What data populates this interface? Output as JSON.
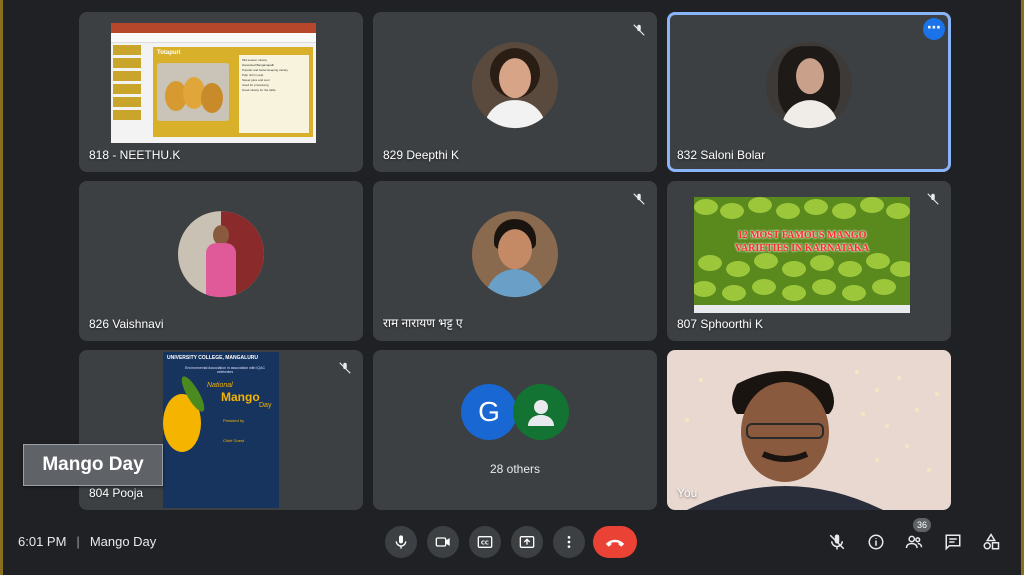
{
  "tiles": [
    {
      "name": "818 - NEETHU.K"
    },
    {
      "name": "829 Deepthi K"
    },
    {
      "name": "832 Saloni Bolar"
    },
    {
      "name": "826 Vaishnavi"
    },
    {
      "name": "राम नारायण भट्ट ए"
    },
    {
      "name": "807 Sphoorthi K"
    },
    {
      "name": "804 Pooja"
    },
    {
      "name": "28 others"
    },
    {
      "name": "You"
    }
  ],
  "slide1": {
    "title": "Totapuri",
    "bullets": [
      "Mid season variety",
      "Harvested Banganapalli",
      "Popular and better-keeping variety",
      "Pulp rich in pulp",
      "Sweet juice and sour",
      "Used for processing",
      "Good variety for the table"
    ]
  },
  "slide2": {
    "line1": "12 MOST FAMOUS MANGO",
    "line2": "VARIETIES IN KARNATAKA"
  },
  "slide3": {
    "college": "UNIVERSITY COLLEGE, MANGALURU",
    "assoc": "Environmental Association in association with IQAC celebrates",
    "national": "National",
    "mango": "Mango",
    "day": "Day",
    "presided": "Presided by",
    "chief": "Chief Guest"
  },
  "others": {
    "initial": "G"
  },
  "banner": {
    "text": "Mango Day"
  },
  "bottom": {
    "time": "6:01 PM",
    "separator": "|",
    "meeting": "Mango Day",
    "participants_count": "36"
  },
  "colors": {
    "tile_bg": "#3c4043",
    "active_outline": "#8ab4f8",
    "end_call": "#ea4335",
    "g_avatar": "#1967d2",
    "default_avatar": "#137333"
  }
}
